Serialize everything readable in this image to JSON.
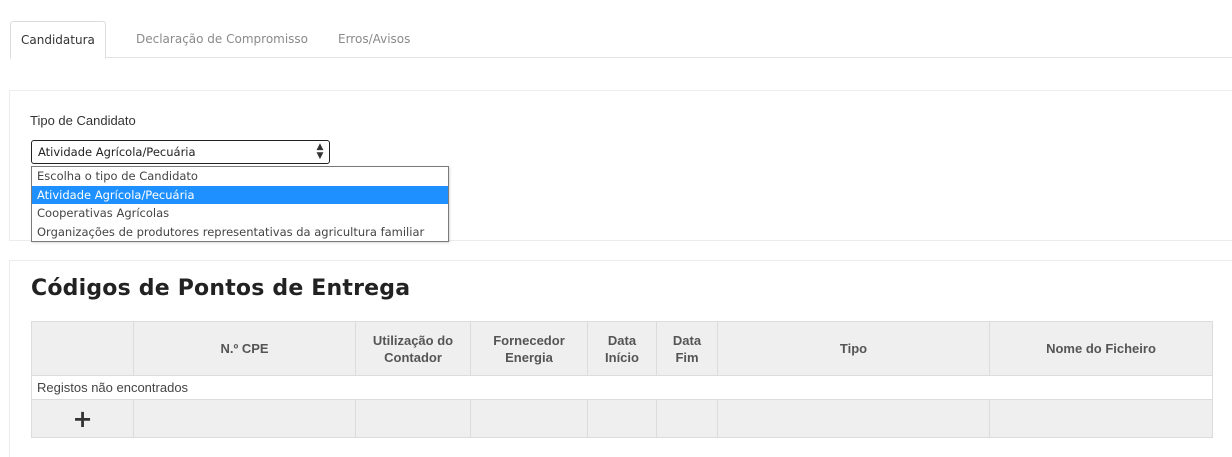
{
  "tabs": [
    {
      "label": "Candidatura"
    },
    {
      "label": "Declaração de Compromisso"
    },
    {
      "label": "Erros/Avisos"
    }
  ],
  "candidate_type": {
    "label": "Tipo de Candidato",
    "selected": "Atividade Agrícola/Pecuária",
    "options": [
      "Escolha o tipo de Candidato",
      "Atividade Agrícola/Pecuária",
      "Cooperativas Agrícolas",
      "Organizações de produtores representativas da agricultura familiar"
    ]
  },
  "cpe_section": {
    "title": "Códigos de Pontos de Entrega",
    "columns": [
      {
        "line1": "",
        "line2": ""
      },
      {
        "line1": "N.º CPE",
        "line2": ""
      },
      {
        "line1": "Utilização do",
        "line2": "Contador"
      },
      {
        "line1": "Fornecedor",
        "line2": "Energia"
      },
      {
        "line1": "Data",
        "line2": "Início"
      },
      {
        "line1": "Data",
        "line2": "Fim"
      },
      {
        "line1": "Tipo",
        "line2": ""
      },
      {
        "line1": "Nome do Ficheiro",
        "line2": ""
      }
    ],
    "empty_message": "Registos não encontrados",
    "add_symbol": "+"
  },
  "colors": {
    "selected_option_bg": "#1e90ff",
    "header_bg": "#efefef"
  },
  "icons": {
    "select_arrow": "updown-arrows-icon",
    "add": "plus-icon"
  }
}
